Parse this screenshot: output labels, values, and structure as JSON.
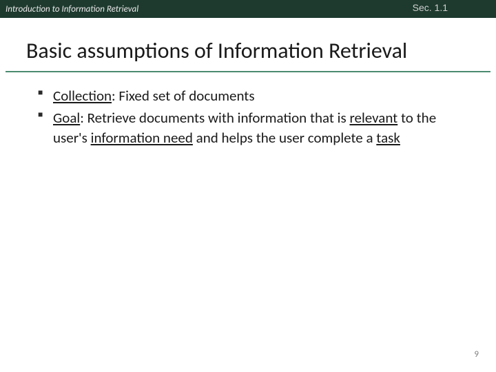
{
  "header": {
    "title": "Introduction to Information Retrieval",
    "section": "Sec. 1.1"
  },
  "slide": {
    "title": "Basic assumptions of Information Retrieval"
  },
  "bullets": [
    {
      "term": "Collection",
      "rest": ": Fixed set of documents"
    },
    {
      "term": "Goal",
      "pre": ": Retrieve documents with information that is ",
      "u1": "relevant",
      "mid1": " to the user's ",
      "u2": "information need",
      "mid2": " and helps the user complete a ",
      "u3": "task"
    }
  ],
  "page_number": "9"
}
